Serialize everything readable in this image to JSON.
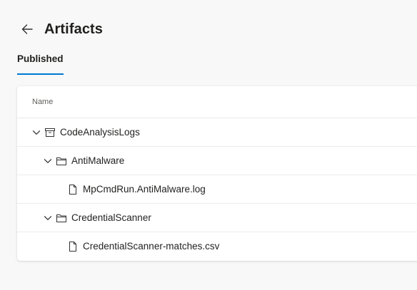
{
  "header": {
    "title": "Artifacts",
    "back_icon": "arrow-left-icon"
  },
  "tabs": [
    {
      "label": "Published",
      "selected": true
    }
  ],
  "table": {
    "column_name": "Name",
    "rows": [
      {
        "label": "CodeAnalysisLogs",
        "icon": "artifact-box-icon",
        "expanded": true,
        "level": 0
      },
      {
        "label": "AntiMalware",
        "icon": "folder-icon",
        "expanded": true,
        "level": 1
      },
      {
        "label": "MpCmdRun.AntiMalware.log",
        "icon": "file-icon",
        "level": 2
      },
      {
        "label": "CredentialScanner",
        "icon": "folder-icon",
        "expanded": true,
        "level": 1
      },
      {
        "label": "CredentialScanner-matches.csv",
        "icon": "file-icon",
        "level": 2
      }
    ]
  },
  "colors": {
    "accent": "#0078d4",
    "background": "#f8f8f8",
    "card": "#ffffff",
    "text": "#201f1e",
    "muted_text": "#605e5c"
  }
}
